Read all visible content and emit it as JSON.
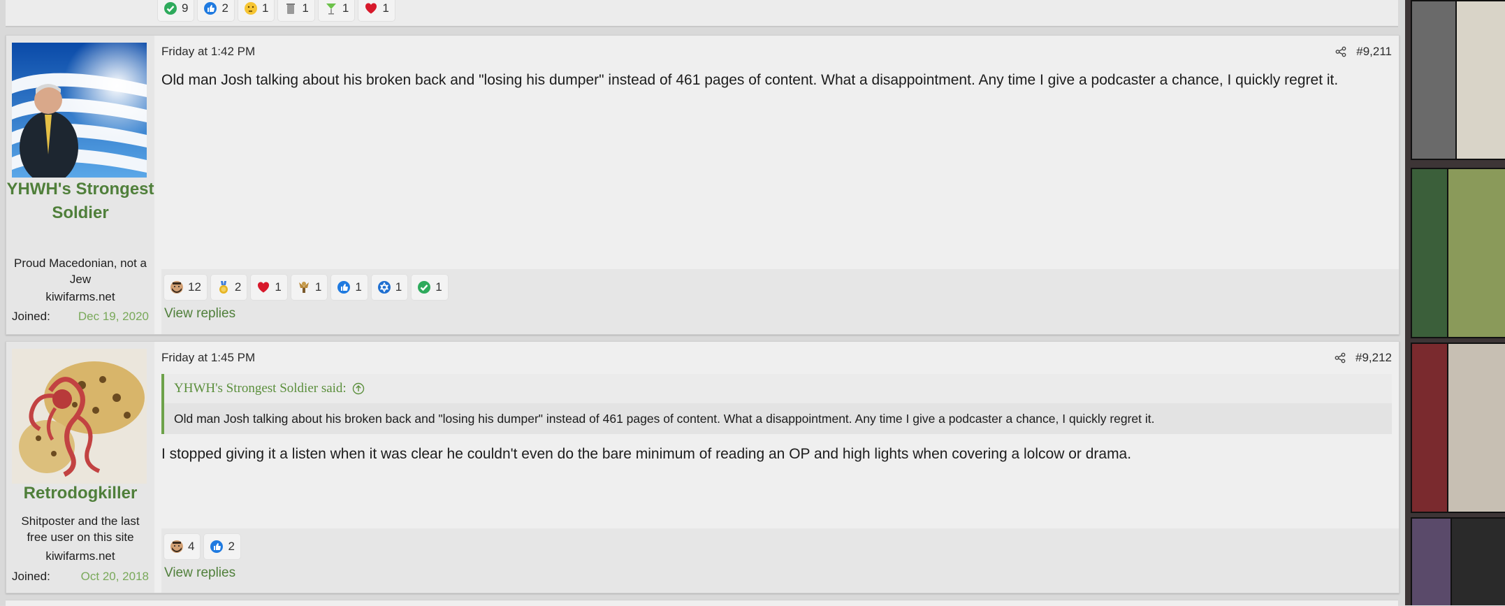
{
  "prev_post": {
    "reactions": [
      {
        "icon": "check-icon",
        "count": "9"
      },
      {
        "icon": "thumbs-up-icon",
        "count": "2"
      },
      {
        "icon": "thinking-face-icon",
        "count": "1"
      },
      {
        "icon": "trash-can-icon",
        "count": "1"
      },
      {
        "icon": "cocktail-glass-icon",
        "count": "1"
      },
      {
        "icon": "heart-icon",
        "count": "1"
      }
    ]
  },
  "posts": [
    {
      "username": "YHWH's Strongest Soldier",
      "user_title": "Proud Macedonian, not a Jew",
      "user_banner": "kiwifarms.net",
      "joined_label": "Joined:",
      "joined_date": "Dec 19, 2020",
      "date": "Friday at 1:42 PM",
      "number": "#9,211",
      "body": "Old man Josh talking about his broken back and \"losing his dumper\" instead of 461 pages of content. What a disappointment. Any time I give a podcaster a chance, I quickly regret it.",
      "reactions": [
        {
          "icon": "bearded-face-icon",
          "count": "12"
        },
        {
          "icon": "gold-medal-icon",
          "count": "2"
        },
        {
          "icon": "heart-icon",
          "count": "1"
        },
        {
          "icon": "winner-figure-icon",
          "count": "1"
        },
        {
          "icon": "thumbs-up-icon",
          "count": "1"
        },
        {
          "icon": "star-of-david-icon",
          "count": "1"
        },
        {
          "icon": "check-icon",
          "count": "1"
        }
      ],
      "view_replies": "View replies"
    },
    {
      "username": "Retrodogkiller",
      "user_title": "Shitposter and the last free user on this site",
      "user_banner": "kiwifarms.net",
      "joined_label": "Joined:",
      "joined_date": "Oct 20, 2018",
      "date": "Friday at 1:45 PM",
      "number": "#9,212",
      "quote_author": "YHWH's Strongest Soldier said:",
      "quote_text": "Old man Josh talking about his broken back and \"losing his dumper\" instead of 461 pages of content. What a disappointment. Any time I give a podcaster a chance, I quickly regret it.",
      "body": "I stopped giving it a listen when it was clear he couldn't even do the bare minimum of reading an OP and high lights when covering a lolcow or drama.",
      "reactions": [
        {
          "icon": "bearded-face-icon",
          "count": "4"
        },
        {
          "icon": "thumbs-up-icon",
          "count": "2"
        }
      ],
      "view_replies": "View replies"
    }
  ],
  "colors": {
    "username": "#4f7f3a",
    "joined_date": "#79a95a",
    "quote_border": "#6da24a"
  }
}
